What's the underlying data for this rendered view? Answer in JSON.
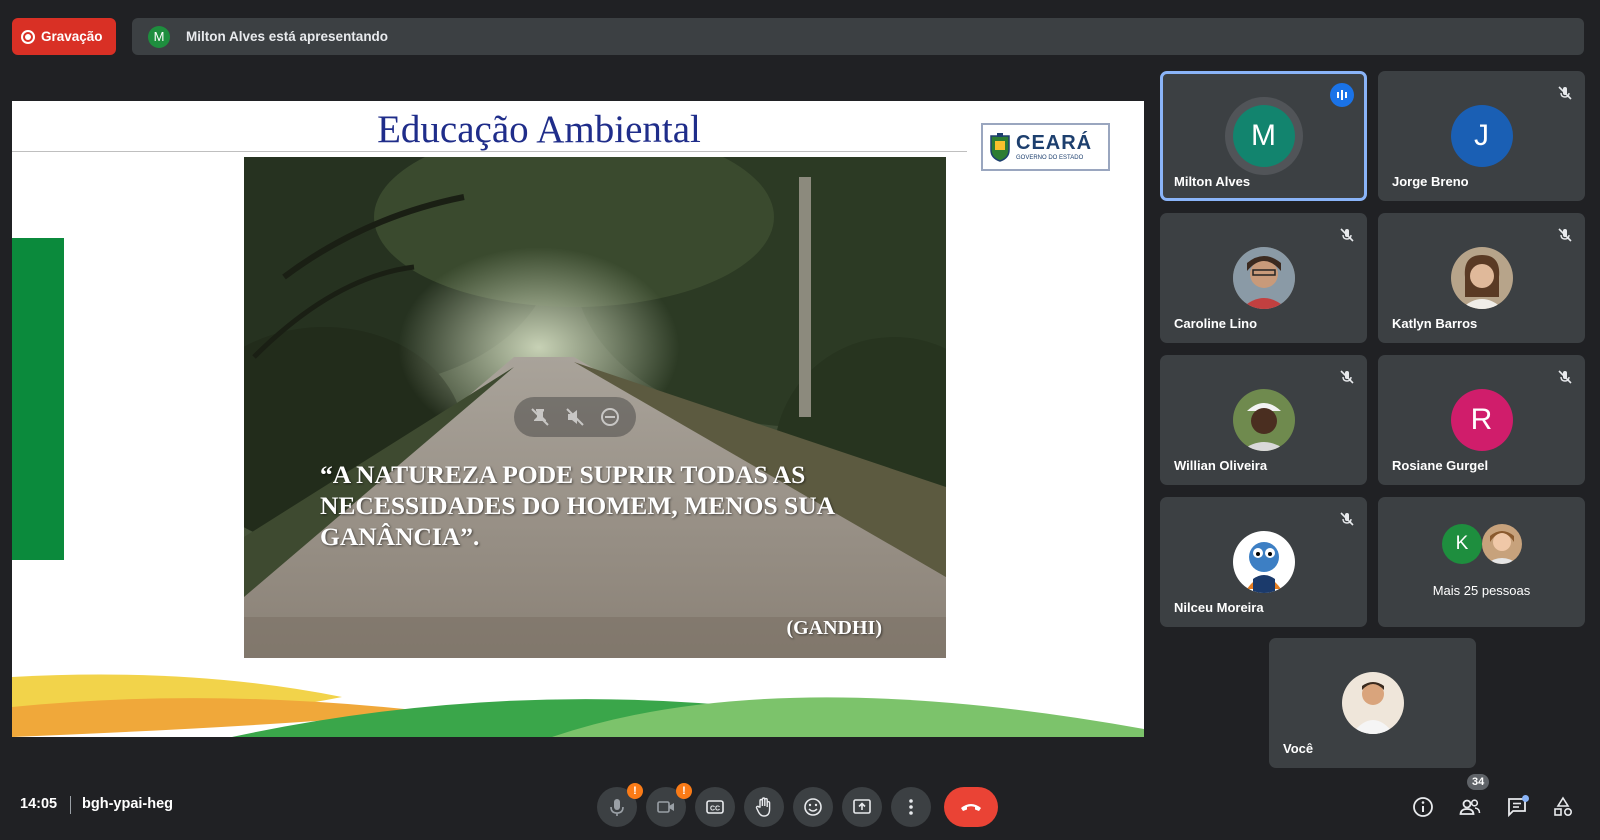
{
  "recording": {
    "label": "Gravação",
    "color": "#d93025"
  },
  "presenter_banner": {
    "initial": "M",
    "text": "Milton Alves está apresentando"
  },
  "slide": {
    "title": "Educação Ambiental",
    "logo_text": "CEARÁ",
    "logo_subtext": "GOVERNO DO ESTADO",
    "quote": "“A NATUREZA PODE SUPRIR TODAS AS NECESSIDADES DO HOMEM, MENOS SUA GANÂNCIA”.",
    "author": "(GANDHI)"
  },
  "participants": [
    {
      "name": "Milton Alves",
      "initial": "M",
      "avatar_color": "#12846e",
      "speaking": true
    },
    {
      "name": "Jorge Breno",
      "initial": "J",
      "avatar_color": "#1a5fb4",
      "muted": true
    },
    {
      "name": "Caroline Lino",
      "photo": true,
      "muted": true
    },
    {
      "name": "Katlyn Barros",
      "photo": true,
      "muted": true
    },
    {
      "name": "Willian Oliveira",
      "photo": true,
      "muted": true
    },
    {
      "name": "Rosiane Gurgel",
      "initial": "R",
      "avatar_color": "#d01d6b",
      "muted": true
    },
    {
      "name": "Nilceu Moreira",
      "photo": true,
      "muted": true
    },
    {
      "name": "Você",
      "photo": true
    }
  ],
  "more_people": {
    "label": "Mais 25 pessoas",
    "initial": "K",
    "avatar_color": "#1e8e3e"
  },
  "bottom_bar": {
    "time": "14:05",
    "meeting_code": "bgh-ypai-heg",
    "mic_warning": "!",
    "camera_warning": "!",
    "people_count": "34"
  },
  "icons": [
    "record-icon",
    "mic-icon",
    "camera-icon",
    "captions-icon",
    "raise-hand-icon",
    "emoji-icon",
    "present-icon",
    "more-options-icon",
    "hangup-icon",
    "info-icon",
    "people-icon",
    "chat-icon",
    "activities-icon",
    "mic-off-icon",
    "speaking-icon"
  ]
}
